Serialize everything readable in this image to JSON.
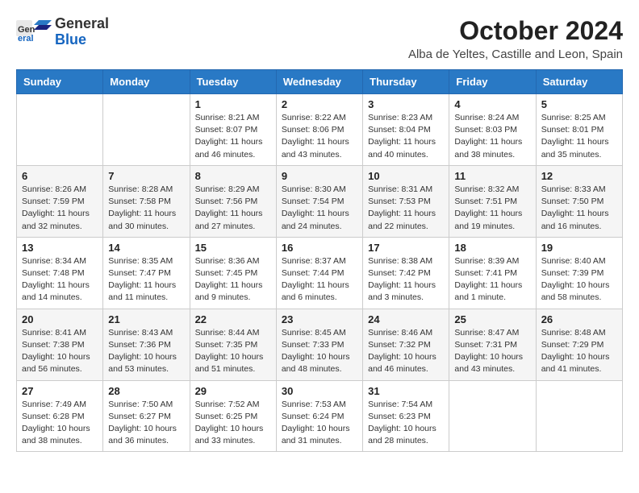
{
  "logo": {
    "general": "General",
    "blue": "Blue"
  },
  "title": "October 2024",
  "subtitle": "Alba de Yeltes, Castille and Leon, Spain",
  "weekdays": [
    "Sunday",
    "Monday",
    "Tuesday",
    "Wednesday",
    "Thursday",
    "Friday",
    "Saturday"
  ],
  "weeks": [
    [
      {
        "day": "",
        "info": ""
      },
      {
        "day": "",
        "info": ""
      },
      {
        "day": "1",
        "info": "Sunrise: 8:21 AM\nSunset: 8:07 PM\nDaylight: 11 hours and 46 minutes."
      },
      {
        "day": "2",
        "info": "Sunrise: 8:22 AM\nSunset: 8:06 PM\nDaylight: 11 hours and 43 minutes."
      },
      {
        "day": "3",
        "info": "Sunrise: 8:23 AM\nSunset: 8:04 PM\nDaylight: 11 hours and 40 minutes."
      },
      {
        "day": "4",
        "info": "Sunrise: 8:24 AM\nSunset: 8:03 PM\nDaylight: 11 hours and 38 minutes."
      },
      {
        "day": "5",
        "info": "Sunrise: 8:25 AM\nSunset: 8:01 PM\nDaylight: 11 hours and 35 minutes."
      }
    ],
    [
      {
        "day": "6",
        "info": "Sunrise: 8:26 AM\nSunset: 7:59 PM\nDaylight: 11 hours and 32 minutes."
      },
      {
        "day": "7",
        "info": "Sunrise: 8:28 AM\nSunset: 7:58 PM\nDaylight: 11 hours and 30 minutes."
      },
      {
        "day": "8",
        "info": "Sunrise: 8:29 AM\nSunset: 7:56 PM\nDaylight: 11 hours and 27 minutes."
      },
      {
        "day": "9",
        "info": "Sunrise: 8:30 AM\nSunset: 7:54 PM\nDaylight: 11 hours and 24 minutes."
      },
      {
        "day": "10",
        "info": "Sunrise: 8:31 AM\nSunset: 7:53 PM\nDaylight: 11 hours and 22 minutes."
      },
      {
        "day": "11",
        "info": "Sunrise: 8:32 AM\nSunset: 7:51 PM\nDaylight: 11 hours and 19 minutes."
      },
      {
        "day": "12",
        "info": "Sunrise: 8:33 AM\nSunset: 7:50 PM\nDaylight: 11 hours and 16 minutes."
      }
    ],
    [
      {
        "day": "13",
        "info": "Sunrise: 8:34 AM\nSunset: 7:48 PM\nDaylight: 11 hours and 14 minutes."
      },
      {
        "day": "14",
        "info": "Sunrise: 8:35 AM\nSunset: 7:47 PM\nDaylight: 11 hours and 11 minutes."
      },
      {
        "day": "15",
        "info": "Sunrise: 8:36 AM\nSunset: 7:45 PM\nDaylight: 11 hours and 9 minutes."
      },
      {
        "day": "16",
        "info": "Sunrise: 8:37 AM\nSunset: 7:44 PM\nDaylight: 11 hours and 6 minutes."
      },
      {
        "day": "17",
        "info": "Sunrise: 8:38 AM\nSunset: 7:42 PM\nDaylight: 11 hours and 3 minutes."
      },
      {
        "day": "18",
        "info": "Sunrise: 8:39 AM\nSunset: 7:41 PM\nDaylight: 11 hours and 1 minute."
      },
      {
        "day": "19",
        "info": "Sunrise: 8:40 AM\nSunset: 7:39 PM\nDaylight: 10 hours and 58 minutes."
      }
    ],
    [
      {
        "day": "20",
        "info": "Sunrise: 8:41 AM\nSunset: 7:38 PM\nDaylight: 10 hours and 56 minutes."
      },
      {
        "day": "21",
        "info": "Sunrise: 8:43 AM\nSunset: 7:36 PM\nDaylight: 10 hours and 53 minutes."
      },
      {
        "day": "22",
        "info": "Sunrise: 8:44 AM\nSunset: 7:35 PM\nDaylight: 10 hours and 51 minutes."
      },
      {
        "day": "23",
        "info": "Sunrise: 8:45 AM\nSunset: 7:33 PM\nDaylight: 10 hours and 48 minutes."
      },
      {
        "day": "24",
        "info": "Sunrise: 8:46 AM\nSunset: 7:32 PM\nDaylight: 10 hours and 46 minutes."
      },
      {
        "day": "25",
        "info": "Sunrise: 8:47 AM\nSunset: 7:31 PM\nDaylight: 10 hours and 43 minutes."
      },
      {
        "day": "26",
        "info": "Sunrise: 8:48 AM\nSunset: 7:29 PM\nDaylight: 10 hours and 41 minutes."
      }
    ],
    [
      {
        "day": "27",
        "info": "Sunrise: 7:49 AM\nSunset: 6:28 PM\nDaylight: 10 hours and 38 minutes."
      },
      {
        "day": "28",
        "info": "Sunrise: 7:50 AM\nSunset: 6:27 PM\nDaylight: 10 hours and 36 minutes."
      },
      {
        "day": "29",
        "info": "Sunrise: 7:52 AM\nSunset: 6:25 PM\nDaylight: 10 hours and 33 minutes."
      },
      {
        "day": "30",
        "info": "Sunrise: 7:53 AM\nSunset: 6:24 PM\nDaylight: 10 hours and 31 minutes."
      },
      {
        "day": "31",
        "info": "Sunrise: 7:54 AM\nSunset: 6:23 PM\nDaylight: 10 hours and 28 minutes."
      },
      {
        "day": "",
        "info": ""
      },
      {
        "day": "",
        "info": ""
      }
    ]
  ]
}
